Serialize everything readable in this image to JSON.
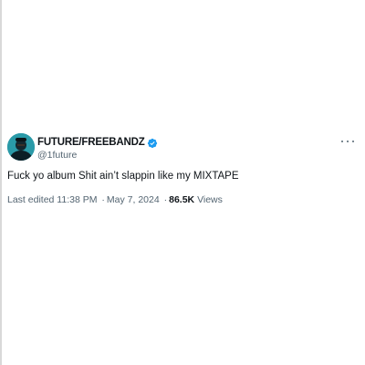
{
  "tweet": {
    "display_name": "FUTURE/FREEBANDZ",
    "handle": "@1future",
    "text": "Fuck yo album Shit ain’t slappin like my MIXTAPE",
    "edited_label": "Last edited",
    "time": "11:38 PM",
    "separator": "·",
    "date": "May 7, 2024",
    "views_count": "86.5K",
    "views_label": "Views"
  },
  "colors": {
    "verified_badge": "#1d9bf0",
    "secondary_text": "#536471",
    "primary_text": "#0f1419"
  },
  "icons": {
    "verified": "verified-badge-icon",
    "more": "more-options-icon"
  }
}
